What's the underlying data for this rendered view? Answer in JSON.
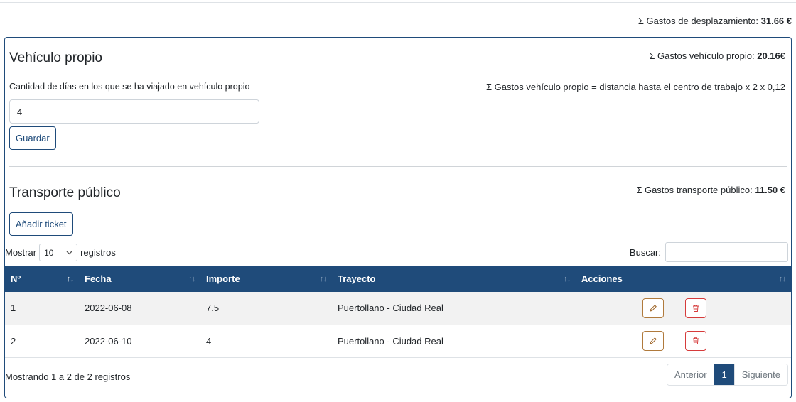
{
  "travel_total": {
    "label": "Σ Gastos de desplazamiento:",
    "value": "31.66 €"
  },
  "vehicle": {
    "title": "Vehículo propio",
    "total_label": "Σ Gastos vehículo propio:",
    "total_value": "20.16€",
    "formula": "Σ Gastos vehículo propio = distancia hasta el centro de trabajo x 2 x 0,12",
    "days_label": "Cantidad de días en los que se ha viajado en vehículo propio",
    "days_value": "4",
    "save_label": "Guardar"
  },
  "public": {
    "title": "Transporte público",
    "total_label": "Σ Gastos transporte público:",
    "total_value": "11.50 €",
    "add_label": "Añadir ticket"
  },
  "datatable": {
    "show_label": "Mostrar",
    "length_value": "10",
    "records_label": "registros",
    "search_label": "Buscar:",
    "columns": [
      "Nº",
      "Fecha",
      "Importe",
      "Trayecto",
      "Acciones"
    ],
    "rows": [
      {
        "n": "1",
        "fecha": "2022-06-08",
        "importe": "7.5",
        "trayecto": "Puertollano - Ciudad Real"
      },
      {
        "n": "2",
        "fecha": "2022-06-10",
        "importe": "4",
        "trayecto": "Puertollano - Ciudad Real"
      }
    ],
    "info": "Mostrando 1 a 2 de 2 registros",
    "pagination": {
      "prev": "Anterior",
      "current": "1",
      "next": "Siguiente"
    }
  },
  "colors": {
    "primary": "#1f4b7a",
    "edit": "#a0672a",
    "delete": "#d63b3b"
  }
}
